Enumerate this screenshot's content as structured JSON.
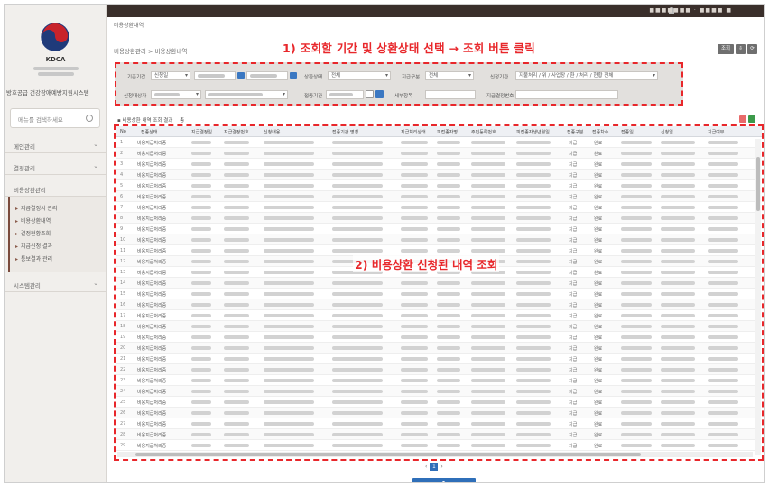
{
  "colors": {
    "accent": "#e8272b",
    "primary": "#2f6fb9",
    "topbar": "#3a2f2b",
    "sidebar": "#f1efec"
  },
  "logo": {
    "name": "KDCA"
  },
  "sidebar": {
    "system_title": "방호공급 건강장애예방지원시스템",
    "search_placeholder": "메뉴를 검색하세요",
    "menus": [
      {
        "label": "메인관리"
      },
      {
        "label": "결정관리"
      },
      {
        "label": "비용상환관리"
      },
      {
        "label": "시스템관리"
      }
    ],
    "submenu": [
      {
        "label": "지급결정서 관리"
      },
      {
        "label": "비용상환내역"
      },
      {
        "label": "결정현황조회"
      },
      {
        "label": "지급신청 결과"
      },
      {
        "label": "통보결과 관리"
      }
    ]
  },
  "page": {
    "small_title": "비용상환내역",
    "breadcrumb": "비용상환관리 > 비용상환내역"
  },
  "annotations": {
    "step1": "1) 조회할 기간 및 상환상태 선택 → 조회 버튼 클릭",
    "step2": "2) 비용상환 신청된 내역 조회"
  },
  "toolbar": {
    "btn_search": "조회",
    "btn_a": "⇩",
    "btn_b": "⟳"
  },
  "filter": {
    "period_label": "기준기간",
    "period_value": "신청일",
    "status_label": "상환상태",
    "status_value": "전체",
    "type_label": "지급구분",
    "type_value": "전체",
    "org_label": "신청기관",
    "org_value": "지불처리 / 위 / 사업장 / 환 / 처리 / 현황 전체",
    "target_label": "신청대상자",
    "name_label": "접종기관",
    "name_placeholder": "기관명 입력",
    "reg_label": "세부항목",
    "extra_label": "지급결정번호"
  },
  "grid": {
    "title": "비용상환 내역 조회 결과",
    "count_prefix": "총",
    "headers": [
      "No",
      "접종상태",
      "지급결정일",
      "지급결정번호",
      "신청내용",
      "접종기관 명칭",
      "지급처리상태",
      "피접종자명",
      "주민등록번호",
      "피접종자생년월일",
      "접종구분",
      "접종차수",
      "접종일",
      "신청일",
      "지급여부"
    ],
    "rows": [
      {
        "no": "1",
        "type": "비용지급처리중",
        "a": "지급",
        "b": "완료"
      },
      {
        "no": "2",
        "type": "비용지급처리중",
        "a": "지급",
        "b": "완료"
      },
      {
        "no": "3",
        "type": "비용지급처리중",
        "a": "지급",
        "b": "완료"
      },
      {
        "no": "4",
        "type": "비용지급처리중",
        "a": "지급",
        "b": "완료"
      },
      {
        "no": "5",
        "type": "비용지급처리중",
        "a": "지급",
        "b": "완료"
      },
      {
        "no": "6",
        "type": "비용지급처리중",
        "a": "지급",
        "b": "완료"
      },
      {
        "no": "7",
        "type": "비용지급처리중",
        "a": "지급",
        "b": "완료"
      },
      {
        "no": "8",
        "type": "비용지급처리중",
        "a": "지급",
        "b": "완료"
      },
      {
        "no": "9",
        "type": "비용지급처리중",
        "a": "지급",
        "b": "완료"
      },
      {
        "no": "10",
        "type": "비용지급처리중",
        "a": "지급",
        "b": "완료"
      },
      {
        "no": "11",
        "type": "비용지급처리중",
        "a": "지급",
        "b": "완료"
      },
      {
        "no": "12",
        "type": "비용지급처리중",
        "a": "지급",
        "b": "완료"
      },
      {
        "no": "13",
        "type": "비용지급처리중",
        "a": "지급",
        "b": "완료"
      },
      {
        "no": "14",
        "type": "비용지급처리중",
        "a": "지급",
        "b": "완료"
      },
      {
        "no": "15",
        "type": "비용지급처리중",
        "a": "지급",
        "b": "완료"
      },
      {
        "no": "16",
        "type": "비용지급처리중",
        "a": "지급",
        "b": "완료"
      },
      {
        "no": "17",
        "type": "비용지급처리중",
        "a": "지급",
        "b": "완료"
      },
      {
        "no": "18",
        "type": "비용지급처리중",
        "a": "지급",
        "b": "완료"
      },
      {
        "no": "19",
        "type": "비용지급처리중",
        "a": "지급",
        "b": "완료"
      },
      {
        "no": "20",
        "type": "비용지급처리중",
        "a": "지급",
        "b": "완료"
      },
      {
        "no": "21",
        "type": "비용지급처리중",
        "a": "지급",
        "b": "완료"
      },
      {
        "no": "22",
        "type": "비용지급처리중",
        "a": "지급",
        "b": "완료"
      },
      {
        "no": "23",
        "type": "비용지급처리중",
        "a": "지급",
        "b": "완료"
      },
      {
        "no": "24",
        "type": "비용지급처리중",
        "a": "지급",
        "b": "완료"
      },
      {
        "no": "25",
        "type": "비용지급처리중",
        "a": "지급",
        "b": "완료"
      },
      {
        "no": "26",
        "type": "비용지급처리중",
        "a": "지급",
        "b": "완료"
      },
      {
        "no": "27",
        "type": "비용지급처리중",
        "a": "지급",
        "b": "완료"
      },
      {
        "no": "28",
        "type": "비용지급처리중",
        "a": "지급",
        "b": "완료"
      },
      {
        "no": "29",
        "type": "비용지급처리중",
        "a": "지급",
        "b": "완료"
      }
    ]
  },
  "pager": {
    "prev": "‹",
    "current": "1",
    "next": "›"
  }
}
